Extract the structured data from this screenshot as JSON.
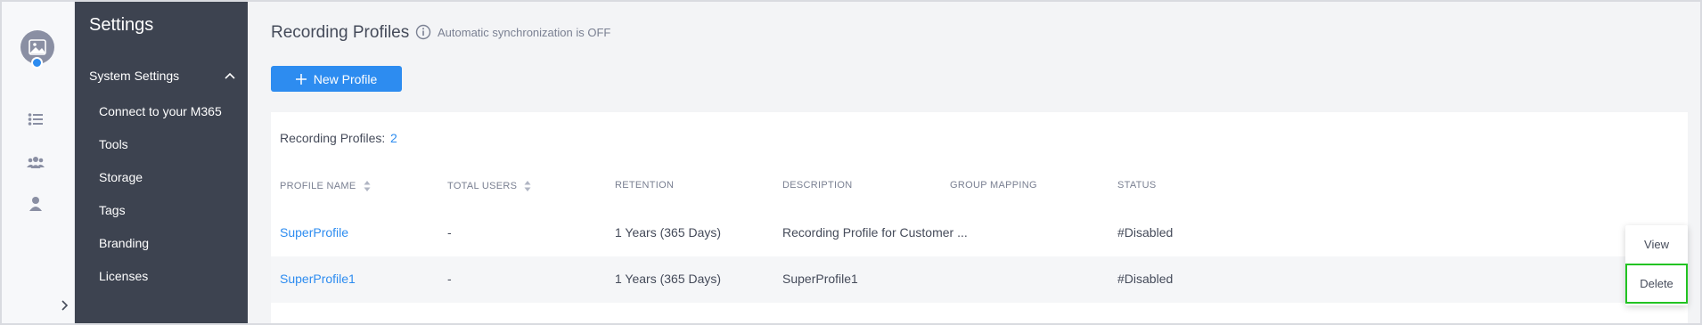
{
  "nav": {
    "title": "Settings",
    "group_label": "System Settings",
    "items": [
      {
        "label": "Connect to your M365"
      },
      {
        "label": "Tools"
      },
      {
        "label": "Storage"
      },
      {
        "label": "Tags"
      },
      {
        "label": "Branding"
      },
      {
        "label": "Licenses"
      }
    ]
  },
  "rail": {
    "icons": [
      "list-icon",
      "users-icon",
      "user-icon"
    ],
    "toggle_icon": "chevron-right-icon"
  },
  "main": {
    "title": "Recording Profiles",
    "sync_status": "Automatic synchronization is OFF",
    "new_button_label": "New Profile",
    "count_label": "Recording Profiles:",
    "count_value": "2"
  },
  "table": {
    "columns": [
      {
        "label": "PROFILE NAME",
        "sortable": true
      },
      {
        "label": "TOTAL USERS",
        "sortable": true
      },
      {
        "label": "RETENTION",
        "sortable": false
      },
      {
        "label": "DESCRIPTION",
        "sortable": false
      },
      {
        "label": "GROUP MAPPING",
        "sortable": false
      },
      {
        "label": "STATUS",
        "sortable": false
      }
    ],
    "rows": [
      {
        "name": "SuperProfile",
        "total_users": "-",
        "retention": "1 Years (365 Days)",
        "description": "Recording Profile for Customer ...",
        "group_mapping": "",
        "status": "#Disabled"
      },
      {
        "name": "SuperProfile1",
        "total_users": "-",
        "retention": "1 Years (365 Days)",
        "description": "SuperProfile1",
        "group_mapping": "",
        "status": "#Disabled"
      }
    ]
  },
  "context_menu": {
    "items": [
      {
        "label": "View"
      },
      {
        "label": "Delete"
      }
    ],
    "highlighted": "Delete",
    "highlight_color": "#22c322"
  },
  "colors": {
    "accent": "#2d8cf0",
    "nav_bg": "#3d4350",
    "page_bg": "#f3f4f6"
  }
}
